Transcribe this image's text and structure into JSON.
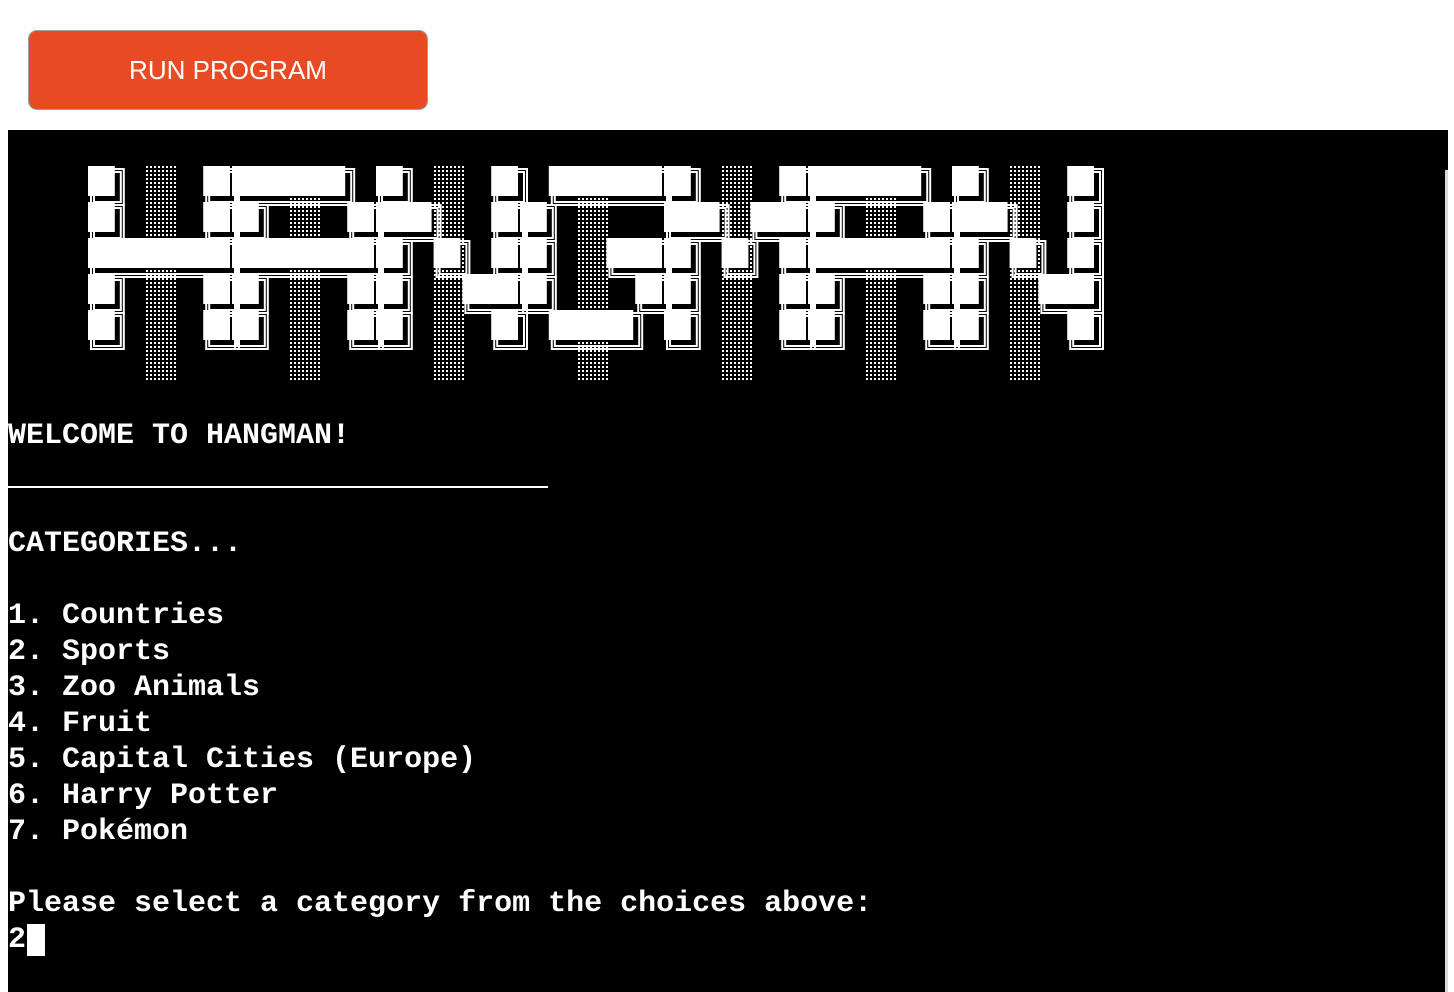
{
  "run_button": {
    "label": "RUN PROGRAM"
  },
  "terminal": {
    "banner_logo_text": "HANGMAN",
    "welcome": "WELCOME TO HANGMAN!",
    "categories_heading": "CATEGORIES...",
    "categories": [
      "1. Countries",
      "2. Sports",
      "3. Zoo Animals",
      "4. Fruit",
      "5. Capital Cities (Europe)",
      "6. Harry Potter",
      "7. Pokémon"
    ],
    "prompt": "Please select a category from the choices above:",
    "input_value": "2"
  },
  "colors": {
    "button_bg": "#e84a23",
    "terminal_bg": "#000000",
    "terminal_fg": "#ffffff"
  }
}
